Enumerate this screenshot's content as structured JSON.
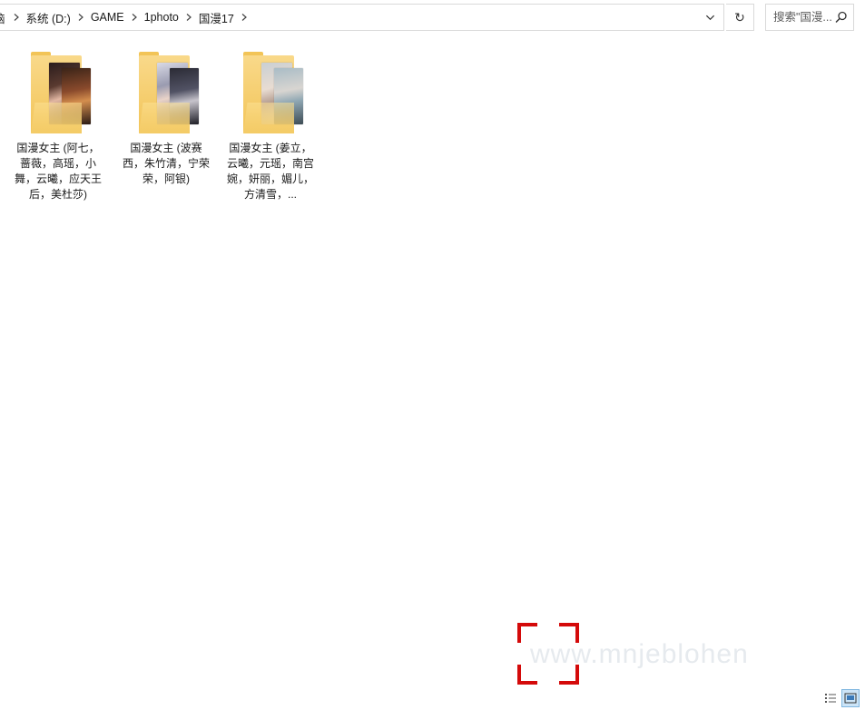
{
  "address_bar": {
    "crumbs": [
      "脑",
      "系统 (D:)",
      "GAME",
      "1photo",
      "国漫17"
    ]
  },
  "search": {
    "placeholder": "搜索\"国漫..."
  },
  "folders": [
    {
      "label": "国漫女主 (阿七，蔷薇，高瑶，小舞，云曦，应天王后，美杜莎)",
      "image_colors": [
        "#3a2a2a",
        "#7a3b2c"
      ]
    },
    {
      "label": "国漫女主 (波赛西，朱竹清，宁荣荣，阿银)",
      "image_colors": [
        "#6e6f80",
        "#2b2b35"
      ]
    },
    {
      "label": "国漫女主 (姜立，云曦，元瑶，南宫婉，妍丽，媚儿，方清雪，...",
      "image_colors": [
        "#c8c2be",
        "#8fa7b3"
      ]
    }
  ],
  "watermark": {
    "text": "www.mnjeblohen",
    "accent_color": "#d40a0a"
  },
  "view_toggles": {
    "details_icon": "details-view-icon",
    "large_icons_icon": "large-icons-view-icon"
  },
  "colors": {
    "folder_yellow": "#f2c457",
    "selection_blue": "#cce4f7",
    "border": "#d9d9d9"
  }
}
